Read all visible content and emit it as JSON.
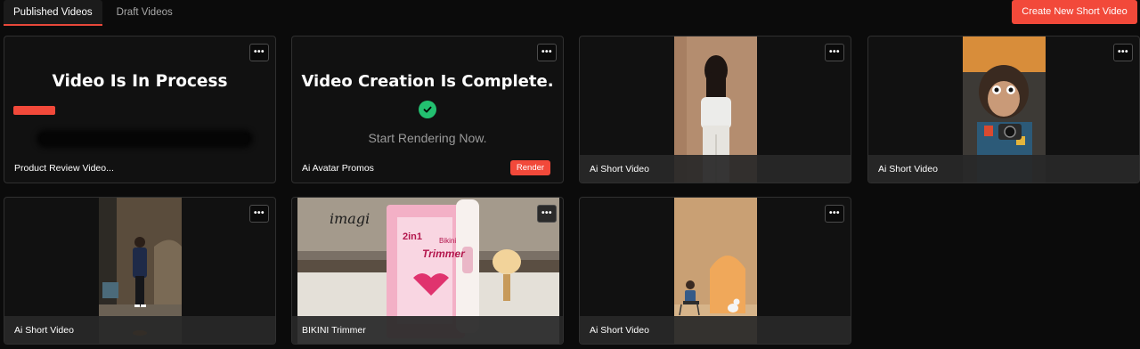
{
  "tabs": [
    {
      "label": "Published Videos",
      "active": true
    },
    {
      "label": "Draft Videos",
      "active": false
    }
  ],
  "create_button": "Create New Short Video",
  "more_icon": "more-horizontal-icon",
  "cards": [
    {
      "caption": "Product Review Video...",
      "status_title": "Video Is In Process"
    },
    {
      "caption": "Ai Avatar Promos",
      "status_title": "Video Creation Is Complete.",
      "status_subtitle": "Start Rendering Now.",
      "action_label": "Render"
    },
    {
      "caption": "Ai Short Video"
    },
    {
      "caption": "Ai Short Video"
    },
    {
      "caption": "Ai Short Video"
    },
    {
      "caption": "BIKINI Trimmer",
      "thumb_text": [
        "imagi",
        "2in1",
        "Bikini",
        "Trimmer"
      ]
    },
    {
      "caption": "Ai Short Video"
    }
  ],
  "colors": {
    "accent": "#f2493a",
    "success": "#23c070",
    "background": "#0b0b0b"
  }
}
